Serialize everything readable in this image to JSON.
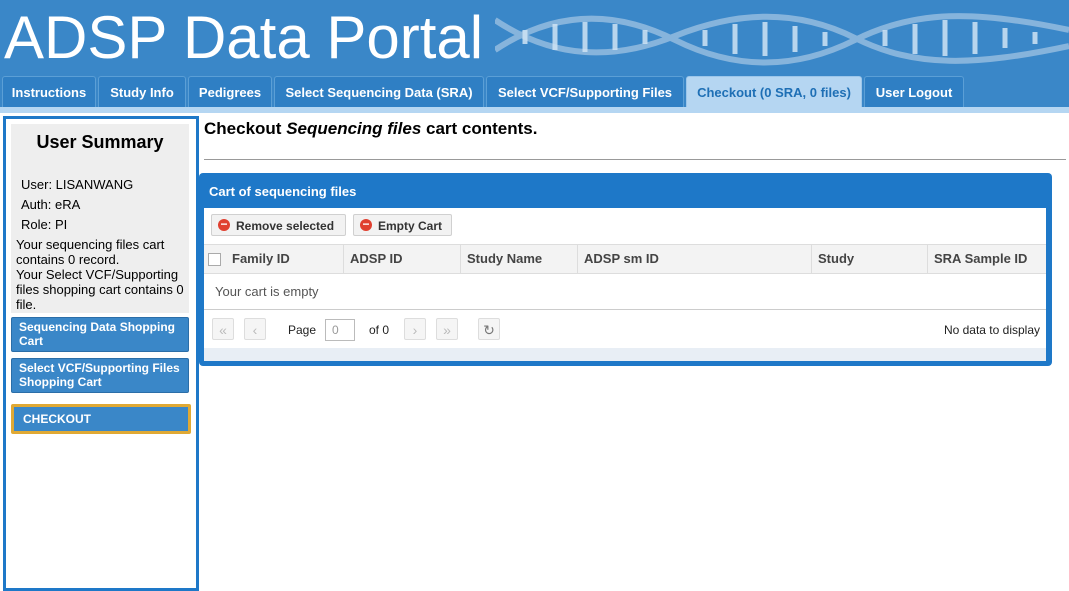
{
  "header": {
    "title": "ADSP Data Portal"
  },
  "tabs": [
    {
      "label": "Instructions"
    },
    {
      "label": "Study Info"
    },
    {
      "label": "Pedigrees"
    },
    {
      "label": "Select Sequencing Data (SRA)"
    },
    {
      "label": "Select VCF/Supporting Files"
    },
    {
      "label": "Checkout (0 SRA, 0 files)"
    },
    {
      "label": "User Logout"
    }
  ],
  "sidebar": {
    "title": "User Summary",
    "user": "User: LISANWANG",
    "auth": "Auth: eRA",
    "role": "Role: PI",
    "note1": "Your sequencing files cart contains 0 record.",
    "note2": "Your Select VCF/Supporting files shopping cart contains 0 file.",
    "btn_seq": "Sequencing Data Shopping Cart",
    "btn_vcf": "Select VCF/Supporting Files Shopping Cart",
    "btn_checkout": "CHECKOUT"
  },
  "main": {
    "heading_pre": "Checkout ",
    "heading_em": "Sequencing files",
    "heading_post": " cart contents."
  },
  "panel": {
    "title": "Cart of sequencing files",
    "remove_label": "Remove selected",
    "empty_label": "Empty Cart",
    "columns": [
      "Family ID",
      "ADSP ID",
      "Study Name",
      "ADSP sm ID",
      "Study",
      "SRA Sample ID"
    ],
    "empty_message": "Your cart is empty",
    "pager": {
      "page_label": "Page",
      "page_value": "0",
      "of_label": "of 0",
      "no_data": "No data to display"
    }
  },
  "colors": {
    "header_blue": "#3a87c8",
    "active_tab": "#b5d6f2",
    "checkout_border": "#e0a934"
  }
}
